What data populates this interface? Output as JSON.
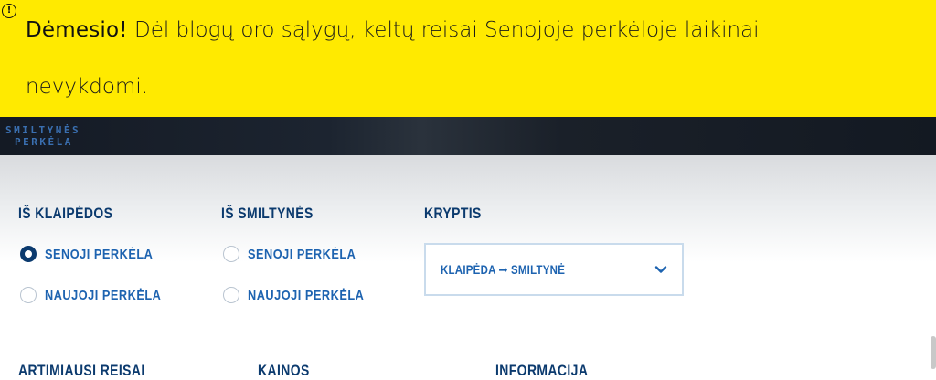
{
  "alert": {
    "icon": "info-circle-icon",
    "bold": "Dėmesio!",
    "message": " Dėl blogų oro sąlygų, keltų reisai Senojoje perkėloje laikinai nevykdomi."
  },
  "header": {
    "logo_line1": "SMILTYNĖS",
    "logo_line2": "PERKĖLA"
  },
  "routes": {
    "from_klaipeda": {
      "title": "IŠ KLAIPĖDOS",
      "options": [
        "SENOJI PERKĖLA",
        "NAUJOJI PERKĖLA"
      ],
      "selected": "SENOJI PERKĖLA"
    },
    "from_smiltyne": {
      "title": "IŠ SMILTYNĖS",
      "options": [
        "SENOJI PERKĖLA",
        "NAUJOJI PERKĖLA"
      ],
      "selected": null
    },
    "direction": {
      "title": "KRYPTIS",
      "value": "KLAIPĖDA ➞ SMILTYNĖ",
      "icon": "chevron-down-icon"
    }
  },
  "bottom_sections": [
    "ARTIMIAUSI REISAI",
    "KAINOS",
    "INFORMACIJA"
  ],
  "colors": {
    "alert_bg": "#ffea00",
    "navy": "#0b3a6e",
    "link_blue": "#1d63b0"
  }
}
